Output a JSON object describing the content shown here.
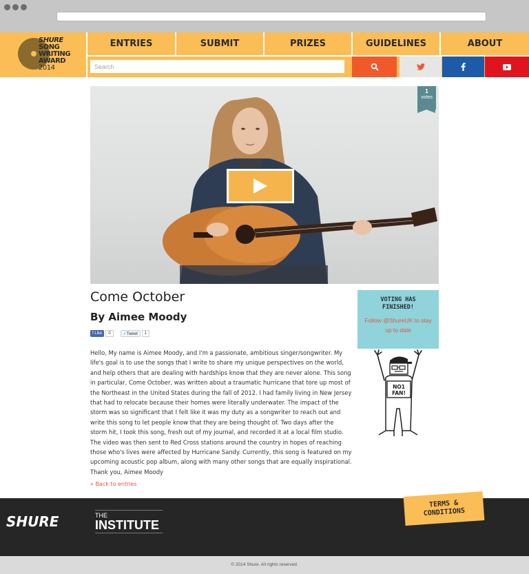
{
  "header": {
    "logo": {
      "brand": "SHURE",
      "line1": "SONG",
      "line2": "WRITING",
      "line3": "AWARD",
      "year": "2014"
    },
    "nav": [
      {
        "label": "ENTRIES",
        "name": "nav-entries"
      },
      {
        "label": "SUBMIT",
        "name": "nav-submit"
      },
      {
        "label": "PRIZES",
        "name": "nav-prizes"
      },
      {
        "label": "GUIDELINES",
        "name": "nav-guidelines"
      },
      {
        "label": "ABOUT",
        "name": "nav-about"
      }
    ],
    "search": {
      "placeholder": "Search"
    },
    "colors": {
      "accent": "#fbbd55",
      "search_button": "#f05a2a",
      "twitter_button": "#e6e6e6",
      "facebook_button": "#1d5aa8",
      "youtube_button": "#e0141e"
    },
    "icons": [
      "search-icon",
      "twitter-icon",
      "facebook-icon",
      "youtube-icon"
    ]
  },
  "video": {
    "votes_count": "1",
    "votes_label": "votes",
    "play_icon": "play-icon"
  },
  "entry": {
    "title": "Come October",
    "byline": "By Aimee Moody",
    "like": {
      "label": "Like",
      "count": "0"
    },
    "tweet": {
      "label": "Tweet",
      "count": "1"
    },
    "body": "Hello, My name is Aimee Moody, and I'm a passionate, ambitious singer/songwriter. My life's goal is to use the songs that I write to share my unique perspectives on the world, and help others that are dealing with hardships know that they are never alone. This song in particular, Come October, was written about a traumatic hurricane that tore up most of the Northeast in the United States during the fall of 2012. I had family living in New Jersey that had to relocate because their homes were literally underwater. The impact of the storm was so significant that I felt like it was my duty as a songwriter to reach out and write this song to let people know that they are being thought of. Two days after the storm hit, I took this song, fresh out of my journal, and recorded it at a local film studio. The video was then sent to Red Cross stations around the country in hopes of reaching those who's lives were affected by Hurricane Sandy. Currently, this song is featured on my upcoming acoustic pop album, along with many other songs that are equally inspirational. Thank you, Aimee Moody",
    "back_link": "« Back to entries"
  },
  "sidebar": {
    "voting_line1": "VOTING HAS",
    "voting_line2": "FINISHED!",
    "follow_line1": "Follow @ShureUK to stay",
    "follow_line2": "up to date",
    "fan_sign": {
      "line1": "NO1",
      "line2": "FAN!"
    }
  },
  "footer": {
    "shure": "SHURE",
    "institute_the": "THE",
    "institute_name": "INSTITUTE",
    "terms_line1": "TERMS &",
    "terms_line2": "CONDITIONS",
    "copyright": "© 2014 Shure. All rights reserved."
  }
}
